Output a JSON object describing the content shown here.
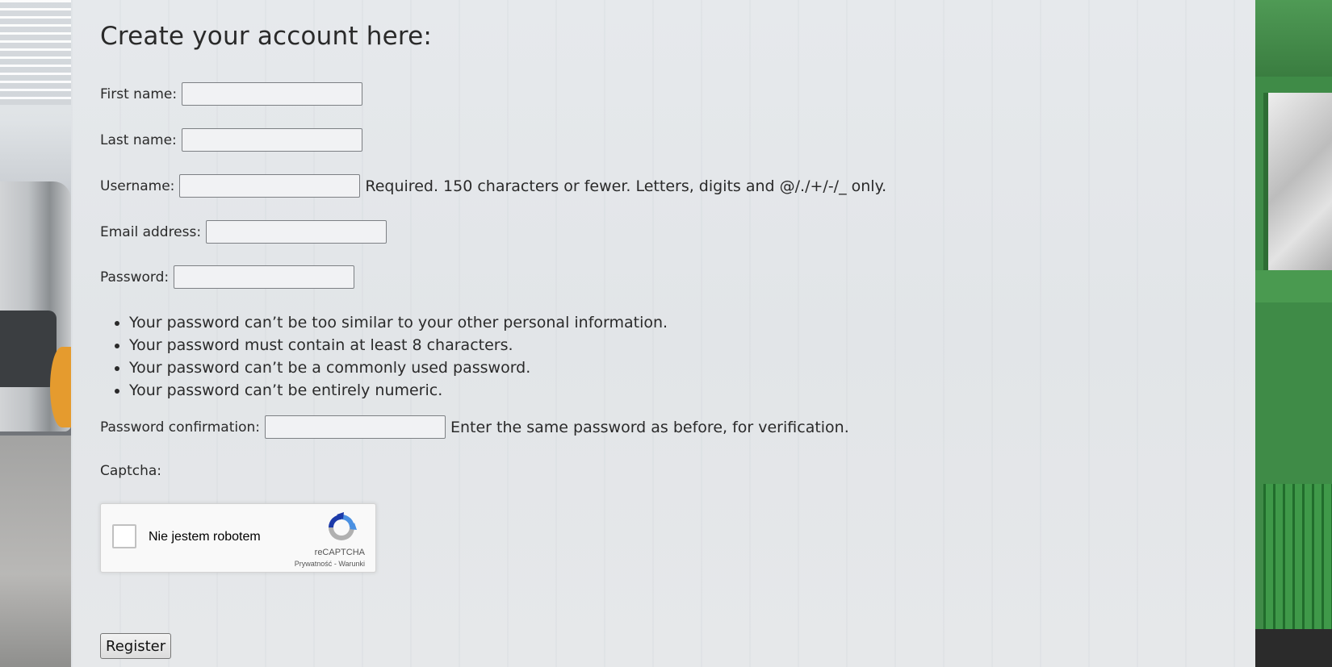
{
  "page": {
    "title": "Create your account here:"
  },
  "form": {
    "first_name": {
      "label": "First name:",
      "value": ""
    },
    "last_name": {
      "label": "Last name:",
      "value": ""
    },
    "username": {
      "label": "Username:",
      "value": "",
      "help": "Required. 150 characters or fewer. Letters, digits and @/./+/-/_ only."
    },
    "email": {
      "label": "Email address:",
      "value": ""
    },
    "password": {
      "label": "Password:",
      "value": ""
    },
    "password_rules": [
      "Your password can’t be too similar to your other personal information.",
      "Your password must contain at least 8 characters.",
      "Your password can’t be a commonly used password.",
      "Your password can’t be entirely numeric."
    ],
    "password_confirmation": {
      "label": "Password confirmation:",
      "value": "",
      "help": "Enter the same password as before, for verification."
    },
    "captcha_label": "Captcha:",
    "register_label": "Register"
  },
  "recaptcha": {
    "checkbox_label": "Nie jestem robotem",
    "brand": "reCAPTCHA",
    "privacy_link": "Prywatność",
    "separator": " - ",
    "terms_link": "Warunki",
    "checked": false
  },
  "icons": {
    "recaptcha_logo": "recaptcha-logo-icon"
  },
  "colors": {
    "panel_background": "#e4e7ea",
    "recaptcha_blue": "#4a90e2",
    "recaptcha_gray": "#b0b0b0"
  }
}
